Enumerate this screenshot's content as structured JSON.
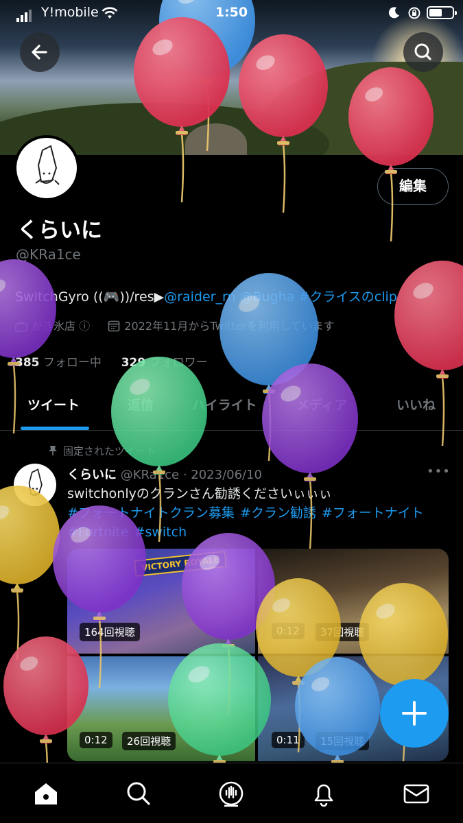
{
  "status_bar": {
    "carrier": "Y!mobile",
    "time": "1:50"
  },
  "profile": {
    "display_name": "くらいに",
    "handle": "@KRa1ce",
    "edit_label": "編集",
    "bio_prefix": "SwitchGyro ((🎮))/res▶",
    "bio_links": [
      "@raider_rn",
      "@Bugha",
      "#クライスのclip"
    ],
    "location": "かき氷店 ⓘ",
    "joined": "2022年11月からTwitterを利用しています",
    "following_count": "385",
    "following_label": "フォロー中",
    "followers_count": "329",
    "followers_label": "フォロワー"
  },
  "tabs": [
    "ツイート",
    "返信",
    "ハイライト",
    "メディア",
    "いいね"
  ],
  "tweet": {
    "pinned_label": "固定されたツイート",
    "name": "くらいに",
    "handle_date": "@KRa1ce · 2023/06/10",
    "text": "switchonlyのクランさん勧誘くださいぃぃぃ",
    "hashtags": [
      "#フォートナイトクラン募集",
      "#クラン勧誘",
      "#フォートナイト",
      "#Fortnite",
      "#switch"
    ],
    "media": [
      {
        "views": "164回視聴"
      },
      {
        "duration": "0:12",
        "views": "37回視聴"
      },
      {
        "duration": "0:12",
        "views": "26回視聴"
      },
      {
        "duration": "0:11",
        "views": "15回視聴"
      }
    ],
    "media_overlay_text": "VICTORY ROYALE"
  },
  "colors": {
    "accent": "#1d9bf0",
    "background": "#000000",
    "secondary_text": "#71767b"
  },
  "icons": {
    "nav": [
      "home-icon",
      "search-icon",
      "spaces-icon",
      "bell-icon",
      "mail-icon"
    ],
    "header": [
      "back-arrow-icon",
      "search-icon"
    ],
    "fab": "plus-icon"
  }
}
